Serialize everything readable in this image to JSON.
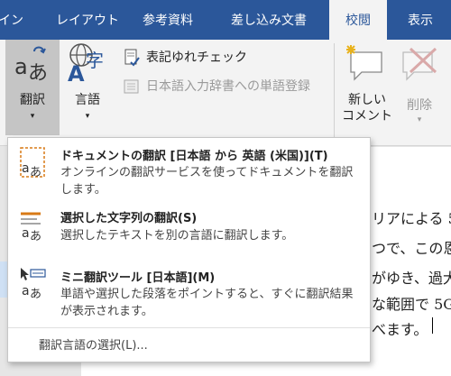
{
  "ribbon_tabs": [
    {
      "label": "イン"
    },
    {
      "label": "レイアウト"
    },
    {
      "label": "参考資料"
    },
    {
      "label": "差し込み文書"
    },
    {
      "label": "校閲"
    },
    {
      "label": "表示"
    }
  ],
  "ribbon": {
    "translate_label": "翻訳",
    "language_label": "言語",
    "notation_check_label": "表記ゆれチェック",
    "register_dict_label": "日本語入力辞書への単語登録",
    "new_comment_line1": "新しい",
    "new_comment_line2": "コメント",
    "delete_label": "削除",
    "caret": "▾"
  },
  "menu": {
    "items": [
      {
        "title": "ドキュメントの翻訳 [日本語 から 英語 (米国)](T)",
        "description": "オンラインの翻訳サービスを使ってドキュメントを翻訳します。"
      },
      {
        "title": "選択した文字列の翻訳(S)",
        "description": "選択したテキストを別の言語に翻訳します。"
      },
      {
        "title": "ミニ翻訳ツール [日本語](M)",
        "description": "単語や選択した段落をポイントすると、すぐに翻訳結果が表示されます。"
      }
    ],
    "footer": "翻訳言語の選択(L)..."
  },
  "document": {
    "lines": [
      "リアによる 5",
      "つで、この恩",
      "がゆき、過大",
      "な範囲で 5G",
      "べます。"
    ]
  },
  "colors": {
    "ribbon_blue": "#2b579a",
    "ribbon_bg": "#f3f3f3",
    "accent_orange": "#d87a16"
  }
}
